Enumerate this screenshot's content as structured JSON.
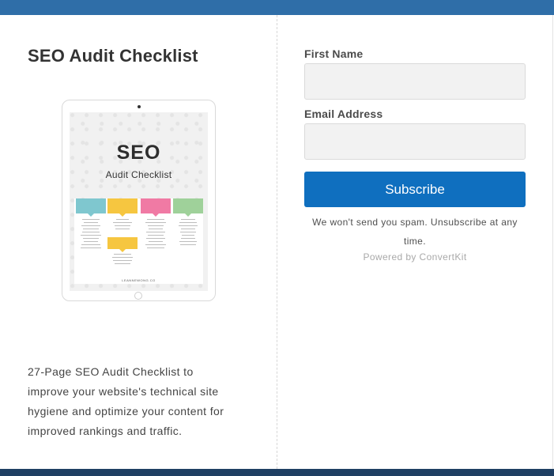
{
  "colors": {
    "top_bar": "#2f6ea8",
    "bottom_bar": "#1f3f63",
    "button": "#0f6fbf",
    "field_bg": "#f2f2f2"
  },
  "left": {
    "title": "SEO Audit Checklist",
    "description": "27-Page SEO Audit Checklist to\nimprove your website's technical site\nhygiene and optimize your content for\nimproved rankings and traffic.",
    "cover": {
      "title": "SEO",
      "subtitle": "Audit Checklist",
      "footer": "LEANNEWONG.CO"
    }
  },
  "form": {
    "first_name_label": "First Name",
    "first_name_value": "",
    "email_label": "Email Address",
    "email_value": "",
    "subscribe_label": "Subscribe",
    "spam_note": "We won't send you spam. Unsubscribe at any time.",
    "powered_by": "Powered by ConvertKit"
  }
}
